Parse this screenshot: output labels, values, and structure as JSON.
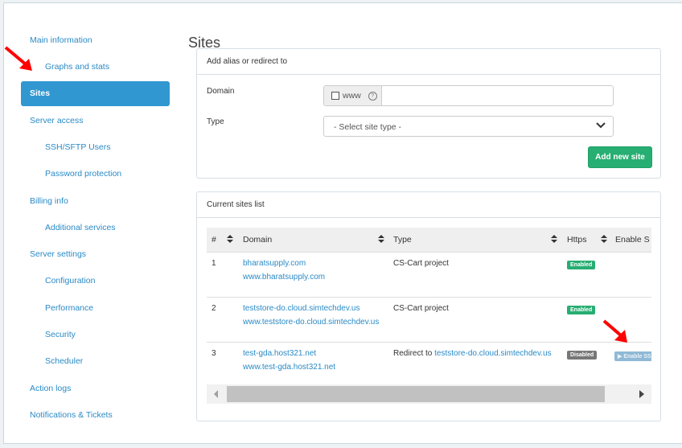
{
  "sidebar": {
    "items": [
      {
        "label": "Main information",
        "level": 1
      },
      {
        "label": "Graphs and stats",
        "level": 2
      },
      {
        "label": "Sites",
        "level": 1,
        "active": true
      },
      {
        "label": "Server access",
        "level": 1
      },
      {
        "label": "SSH/SFTP Users",
        "level": 2
      },
      {
        "label": "Password protection",
        "level": 2
      },
      {
        "label": "Billing info",
        "level": 1
      },
      {
        "label": "Additional services",
        "level": 2
      },
      {
        "label": "Server settings",
        "level": 1
      },
      {
        "label": "Configuration",
        "level": 2
      },
      {
        "label": "Performance",
        "level": 2
      },
      {
        "label": "Security",
        "level": 2
      },
      {
        "label": "Scheduler",
        "level": 2
      },
      {
        "label": "Action logs",
        "level": 1
      },
      {
        "label": "Notifications & Tickets",
        "level": 1
      }
    ]
  },
  "page": {
    "title": "Sites"
  },
  "add_panel": {
    "title": "Add alias or redirect to",
    "domain_label": "Domain",
    "www_label": "www",
    "help_glyph": "?",
    "domain_value": "",
    "type_label": "Type",
    "type_selected": "- Select site type -",
    "submit_label": "Add new site"
  },
  "list_panel": {
    "title": "Current sites list",
    "columns": [
      "#",
      "Domain",
      "Type",
      "Https",
      "Enable S"
    ],
    "rows": [
      {
        "num": "1",
        "domain": "bharatsupply.com",
        "alias": "www.bharatsupply.com",
        "type": "CS-Cart project",
        "type_link": "",
        "https": "Enabled",
        "action": ""
      },
      {
        "num": "2",
        "domain": "teststore-do.cloud.simtechdev.us",
        "alias": "www.teststore-do.cloud.simtechdev.us",
        "type": "CS-Cart project",
        "type_link": "",
        "https": "Enabled",
        "action": ""
      },
      {
        "num": "3",
        "domain": "test-gda.host321.net",
        "alias": "www.test-gda.host321.net",
        "type": "Redirect to ",
        "type_link": "teststore-do.cloud.simtechdev.us",
        "https": "Disabled",
        "action": "▶ Enable SSL"
      }
    ]
  },
  "colors": {
    "accent": "#3097d1",
    "link": "#2a8ac6",
    "success": "#27ae72",
    "disabled": "#777777",
    "annotation_arrow": "#ff0000"
  }
}
